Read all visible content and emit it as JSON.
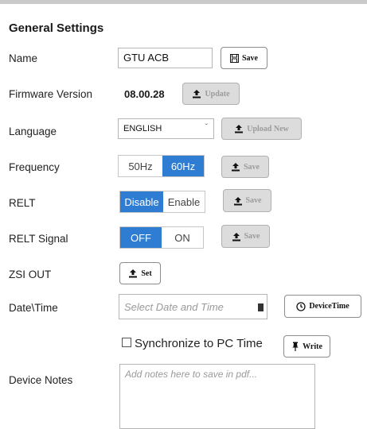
{
  "title": "General Settings",
  "name": {
    "label": "Name",
    "value": "GTU ACB",
    "button": "Save"
  },
  "firmware": {
    "label": "Firmware Version",
    "value": "08.00.28",
    "button": "Update"
  },
  "language": {
    "label": "Language",
    "selected": "ENGLISH",
    "chevron": "ˇ",
    "button": "Upload New"
  },
  "frequency": {
    "label": "Frequency",
    "options": [
      "50Hz",
      "60Hz"
    ],
    "active": "60Hz",
    "button": "Save"
  },
  "relt": {
    "label": "RELT",
    "options": [
      "Disable",
      "Enable"
    ],
    "active": "Disable",
    "button": "Save"
  },
  "relt_signal": {
    "label": "RELT Signal",
    "options": [
      "OFF",
      "ON"
    ],
    "active": "OFF",
    "button": "Save"
  },
  "zsi_out": {
    "label": "ZSI OUT",
    "button": "Set"
  },
  "datetime": {
    "label": "Date\\Time",
    "placeholder": "Select Date and Time",
    "button": "DeviceTime"
  },
  "sync": {
    "label": "Synchronize to PC Time",
    "checked": false,
    "button": "Write"
  },
  "notes": {
    "label": "Device Notes",
    "placeholder": "Add notes here to save in pdf..."
  },
  "icons": {
    "save": "floppy-disk-icon",
    "upload": "upload-icon",
    "calendar": "calendar-icon",
    "clock": "clock-icon",
    "pin": "pin-icon"
  },
  "colors": {
    "accent": "#2f7dd2",
    "disabled_bg": "#dcdcdc"
  }
}
